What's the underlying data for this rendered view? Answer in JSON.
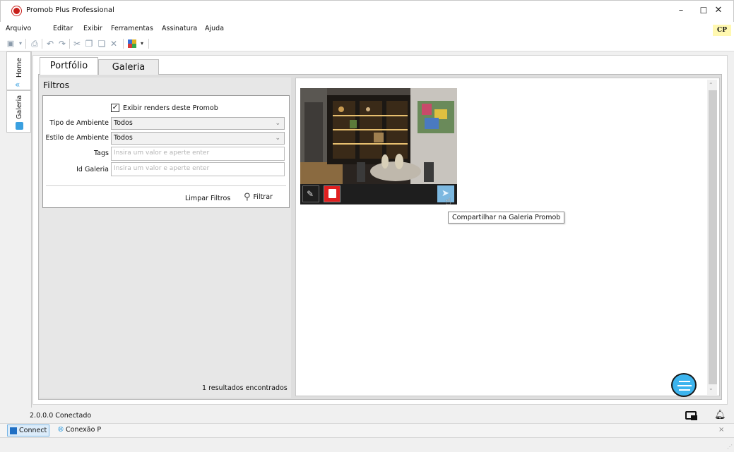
{
  "window": {
    "title": "Promob Plus Professional",
    "minimize": "–",
    "maximize": "☐",
    "close": "✕"
  },
  "menu": {
    "items": [
      "Arquivo",
      "Editar",
      "Exibir",
      "Ferramentas",
      "Assinatura",
      "Ajuda"
    ],
    "badge": "CP"
  },
  "side_tabs": {
    "home": "Home",
    "galeria": "Galeria"
  },
  "tabs": [
    {
      "label": "Portfólio",
      "active": true
    },
    {
      "label": "Galeria",
      "active": false
    }
  ],
  "filters": {
    "title": "Filtros",
    "show_renders_label": "Exibir renders deste Promob",
    "show_renders_checked": true,
    "tipo_ambiente": {
      "label": "Tipo de Ambiente",
      "value": "Todos"
    },
    "estilo_ambiente": {
      "label": "Estilo de Ambiente",
      "value": "Todos"
    },
    "tags": {
      "label": "Tags",
      "placeholder": "Insira um valor e aperte enter"
    },
    "id_galeria": {
      "label": "Id Galeria",
      "placeholder": "Insira um valor e aperte enter"
    },
    "clear_label": "Limpar Filtros",
    "filter_label": "Filtrar",
    "results_text": "1 resultados encontrados"
  },
  "gallery": {
    "tooltip": "Compartilhar na Galeria Promob"
  },
  "status": {
    "text": "2.0.0.0 Conectado"
  },
  "bottom": {
    "connect_label": "Connect",
    "conexao_label": "Conexão P",
    "close": "×"
  },
  "colors": {
    "accent": "#3aa0e0",
    "delete": "#e02020",
    "chat_bubble": "#3cb4ee",
    "brand_red": "#c8201b"
  }
}
